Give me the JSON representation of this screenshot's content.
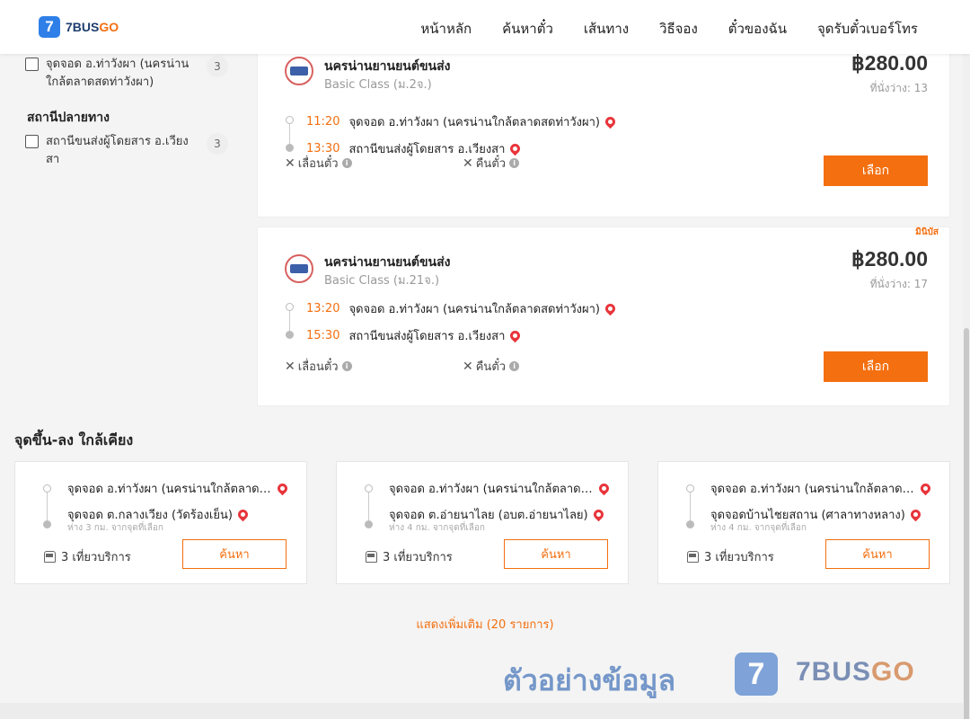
{
  "header": {
    "logo_mark": "7",
    "logo_text_main": "7BUS",
    "logo_text_go": "GO",
    "nav": [
      "หน้าหลัก",
      "ค้นหาตั๋ว",
      "เส้นทาง",
      "วิธีจอง",
      "ตั๋วของฉัน",
      "จุดรับตั๋วเบอร์โทร"
    ]
  },
  "sidebar": {
    "origin_item": {
      "label": "จุดจอด อ.ท่าวังผา (นครน่านใกล้ตลาดสดท่าวังผา)",
      "count": "3"
    },
    "destination_heading": "สถานีปลายทาง",
    "destination_item": {
      "label": "สถานีขนส่งผู้โดยสาร อ.เวียงสา",
      "count": "3"
    }
  },
  "trips": [
    {
      "operator": "นครน่านยานยนต์ขนส่ง",
      "class": "Basic Class (ม.2จ.)",
      "price": "฿280.00",
      "seats": "ที่นั่งว่าง: 13",
      "tag": "",
      "depart_time": "11:20",
      "depart_stop": "จุดจอด อ.ท่าวังผา (นครน่านใกล้ตลาดสดท่าวังผา)",
      "arrive_time": "13:30",
      "arrive_stop": "สถานีขนส่งผู้โดยสาร อ.เวียงสา",
      "change_label": "เลื่อนตั๋ว",
      "refund_label": "คืนตั๋ว",
      "select_label": "เลือก"
    },
    {
      "operator": "นครน่านยานยนต์ขนส่ง",
      "class": "Basic Class (ม.21จ.)",
      "price": "฿280.00",
      "seats": "ที่นั่งว่าง: 17",
      "tag": "มินิบัส",
      "depart_time": "13:20",
      "depart_stop": "จุดจอด อ.ท่าวังผา (นครน่านใกล้ตลาดสดท่าวังผา)",
      "arrive_time": "15:30",
      "arrive_stop": "สถานีขนส่งผู้โดยสาร อ.เวียงสา",
      "change_label": "เลื่อนตั๋ว",
      "refund_label": "คืนตั๋ว",
      "select_label": "เลือก"
    }
  ],
  "nearby": {
    "title": "จุดขึ้น-ลง ใกล้เคียง",
    "cards": [
      {
        "from": "จุดจอด อ.ท่าวังผา (นครน่านใกล้ตลาดสดท่าวังผา)",
        "to": "จุดจอด ต.กลางเวียง (วัดร้องเย็น)",
        "distance": "ห่าง 3 กม. จากจุดที่เลือก",
        "trips": "3 เที่ยวบริการ",
        "search_label": "ค้นหา"
      },
      {
        "from": "จุดจอด อ.ท่าวังผา (นครน่านใกล้ตลาดสดท่าวังผา)",
        "to": "จุดจอด ต.อ่ายนาไลย (อบต.อ่ายนาไลย)",
        "distance": "ห่าง 4 กม. จากจุดที่เลือก",
        "trips": "3 เที่ยวบริการ",
        "search_label": "ค้นหา"
      },
      {
        "from": "จุดจอด อ.ท่าวังผา (นครน่านใกล้ตลาดสดท่าวังผา)",
        "to": "จุดจอดบ้านไชยสถาน (ศาลาทางหลาง)",
        "distance": "ห่าง 4 กม. จากจุดที่เลือก",
        "trips": "3 เที่ยวบริการ",
        "search_label": "ค้นหา"
      }
    ]
  },
  "show_more": "แสดงเพิ่มเติม (20 รายการ)",
  "watermark": {
    "text": "ตัวอย่างข้อมูล",
    "logo_mark": "7",
    "brand_main": "7BUS",
    "brand_go": "GO"
  },
  "colors": {
    "accent": "#f36f10",
    "brand_blue": "#2f7fe8",
    "pin": "#e8353b"
  }
}
